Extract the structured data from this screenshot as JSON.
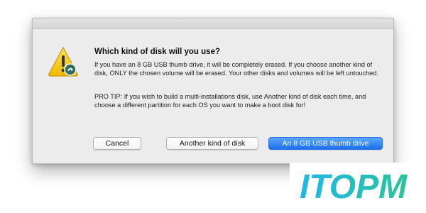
{
  "dialog": {
    "heading": "Which kind of disk will you use?",
    "paragraph1": "If you have an 8 GB USB thumb drive, it will be completely erased. If you choose another kind of disk, ONLY the chosen volume will be erased. Your other disks and volumes will be left untouched.",
    "paragraph2": "PRO TIP: If you wish to build a multi-installations disk, use Another kind of disk each time, and choose a different partition for each OS you want to make a boot disk for!",
    "icon": "warning-icon",
    "buttons": {
      "cancel": "Cancel",
      "another": "Another kind of disk",
      "usb": "An 8 GB USB thumb drive"
    }
  },
  "watermark": {
    "text": "ITOPM",
    "colors": {
      "start": "#1fb7e8",
      "end": "#2bc49a"
    }
  }
}
